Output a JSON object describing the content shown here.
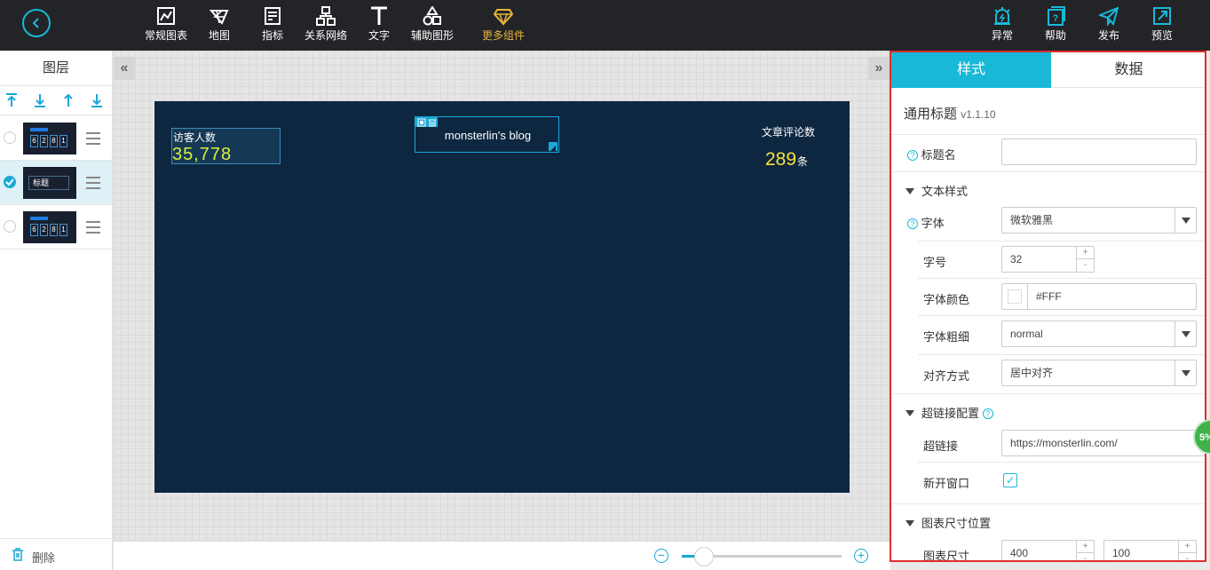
{
  "toolbar": {
    "back_icon": "back-circle-icon",
    "tools": [
      {
        "label": "常规图表",
        "icon": "chart-icon"
      },
      {
        "label": "地图",
        "icon": "map-icon"
      },
      {
        "label": "指标",
        "icon": "indicator-icon"
      },
      {
        "label": "关系网络",
        "icon": "network-icon"
      },
      {
        "label": "文字",
        "icon": "text-icon"
      },
      {
        "label": "辅助图形",
        "icon": "shapes-icon"
      },
      {
        "label": "更多组件",
        "icon": "diamond-icon"
      }
    ],
    "right_tools": [
      {
        "label": "异常",
        "icon": "alert-icon"
      },
      {
        "label": "帮助",
        "icon": "help-icon"
      },
      {
        "label": "发布",
        "icon": "publish-icon"
      },
      {
        "label": "预览",
        "icon": "preview-icon"
      }
    ],
    "accent_color": "#19b8d8",
    "gold_color": "#e8b53a"
  },
  "layers": {
    "title": "图层",
    "items": [
      {
        "thumb_digits": [
          "6",
          "2",
          "8",
          "1"
        ],
        "selected": false
      },
      {
        "thumb_label": "标题",
        "selected": true
      },
      {
        "thumb_digits": [
          "6",
          "2",
          "8",
          "1"
        ],
        "selected": false
      }
    ],
    "delete_label": "删除"
  },
  "canvas": {
    "visitor_label": "访客人数",
    "visitor_value": "35,778",
    "title_text": "monsterlin's blog",
    "comments_label": "文章评论数",
    "comments_value": "289",
    "comments_unit": "条"
  },
  "zoom": {
    "level": 0.14
  },
  "props": {
    "tab_style": "样式",
    "tab_data": "数据",
    "component_name": "通用标题",
    "component_version": "v1.1.10",
    "title_name_label": "标题名",
    "title_name_value": "",
    "text_style_section": "文本样式",
    "font_label": "字体",
    "font_value": "微软雅黑",
    "size_label": "字号",
    "size_value": "32",
    "color_label": "字体颜色",
    "color_value": "#FFF",
    "weight_label": "字体粗细",
    "weight_value": "normal",
    "align_label": "对齐方式",
    "align_value": "居中对齐",
    "link_section": "超链接配置",
    "link_label": "超链接",
    "link_value": "https://monsterlin.com/",
    "newwin_label": "新开窗口",
    "newwin_checked": true,
    "size_pos_section": "图表尺寸位置",
    "chart_size_label": "图表尺寸",
    "width_value": "400",
    "height_value": "100"
  },
  "float_ball_text": "5%"
}
